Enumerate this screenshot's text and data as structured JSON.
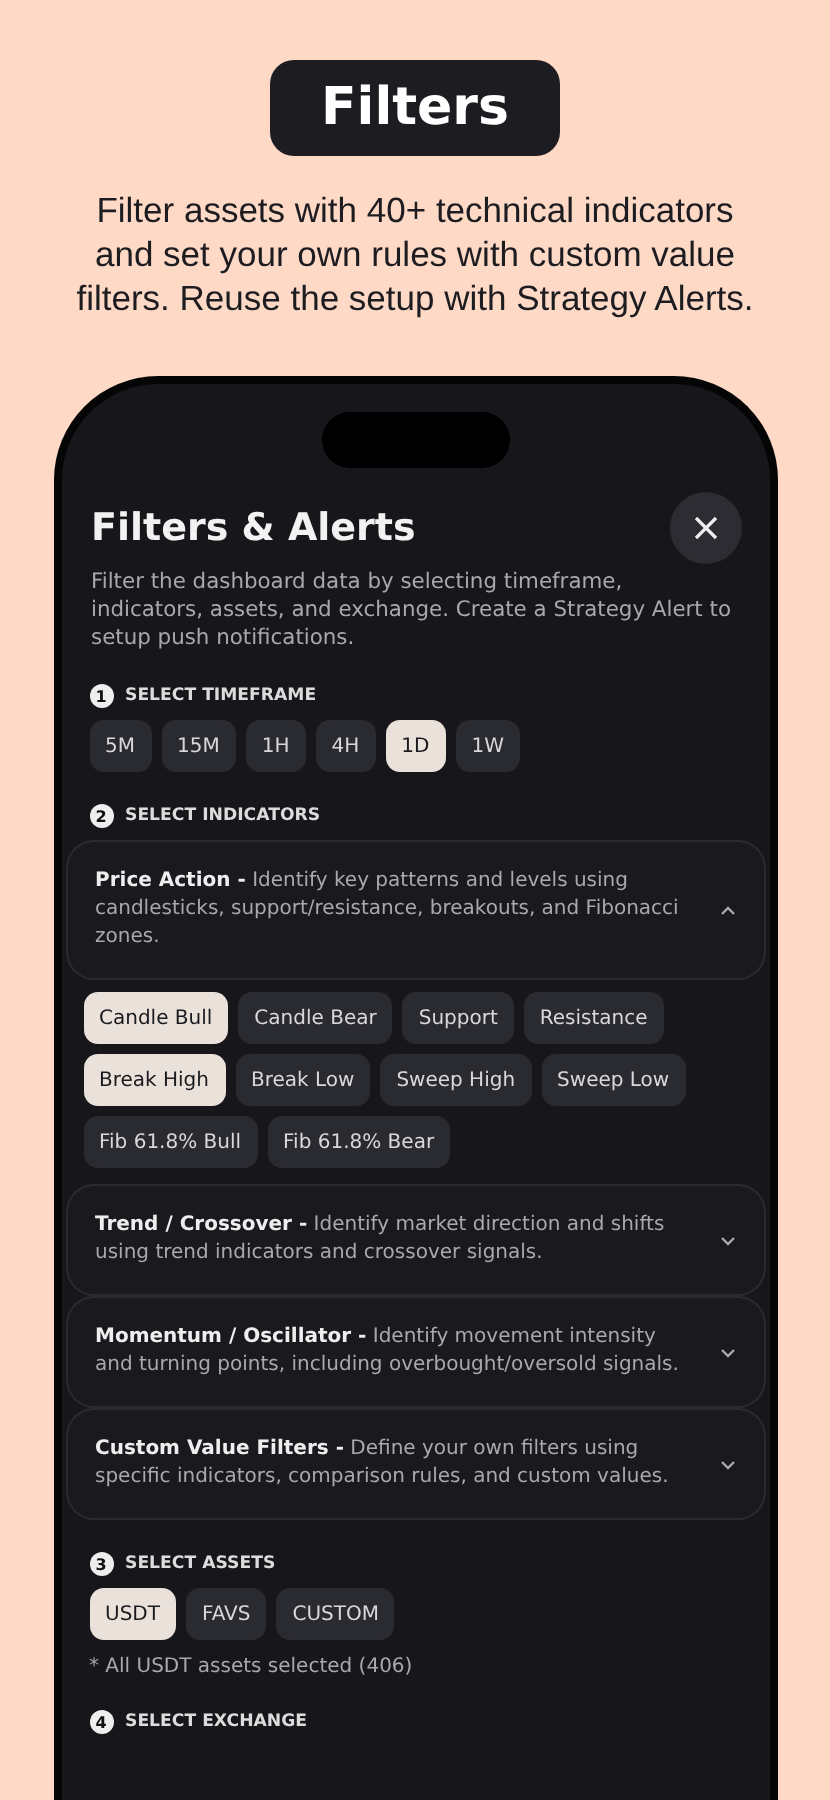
{
  "header": {
    "title": "Filters",
    "subtitle": "Filter assets with 40+ technical indicators and set your own rules with custom value filters. Reuse the setup with Strategy Alerts."
  },
  "screen": {
    "title": "Filters & Alerts",
    "description": "Filter the dashboard data by selecting timeframe, indicators, assets, and exchange. Create a Strategy Alert to setup push notifications.",
    "sections": [
      {
        "number": "1",
        "label": "SELECT TIMEFRAME",
        "kind": "chips",
        "chips": [
          {
            "label": "5M",
            "selected": false
          },
          {
            "label": "15M",
            "selected": false
          },
          {
            "label": "1H",
            "selected": false
          },
          {
            "label": "4H",
            "selected": false
          },
          {
            "label": "1D",
            "selected": true
          },
          {
            "label": "1W",
            "selected": false
          }
        ]
      },
      {
        "number": "2",
        "label": "SELECT INDICATORS",
        "kind": "groups",
        "groups": [
          {
            "text": "**Price Action -** Identify key patterns and levels using candlesticks, support/resistance, breakouts, and Fibonacci zones.",
            "expanded": true,
            "chips": [
              {
                "label": "Candle Bull",
                "selected": true
              },
              {
                "label": "Candle Bear",
                "selected": false
              },
              {
                "label": "Support",
                "selected": false
              },
              {
                "label": "Resistance",
                "selected": false
              },
              {
                "label": "Break High",
                "selected": true
              },
              {
                "label": "Break Low",
                "selected": false
              },
              {
                "label": "Sweep High",
                "selected": false
              },
              {
                "label": "Sweep Low",
                "selected": false
              },
              {
                "label": "Fib 61.8% Bull",
                "selected": false
              },
              {
                "label": "Fib 61.8% Bear",
                "selected": false
              }
            ]
          },
          {
            "text": "**Trend / Crossover -** Identify market direction and shifts using trend indicators and crossover signals.",
            "expanded": false
          },
          {
            "text": "**Momentum / Oscillator -** Identify movement intensity and turning points, including overbought/oversold signals.",
            "expanded": false
          },
          {
            "text": "**Custom Value Filters -** Define your own filters using specific indicators, comparison rules, and custom values.",
            "expanded": false
          }
        ]
      },
      {
        "number": "3",
        "label": "SELECT ASSETS",
        "kind": "chips",
        "chips": [
          {
            "label": "USDT",
            "selected": true
          },
          {
            "label": "FAVS",
            "selected": false
          },
          {
            "label": "CUSTOM",
            "selected": false
          }
        ],
        "note": "* All USDT assets selected (406)"
      },
      {
        "number": "4",
        "label": "SELECT EXCHANGE",
        "kind": "heading"
      }
    ]
  }
}
